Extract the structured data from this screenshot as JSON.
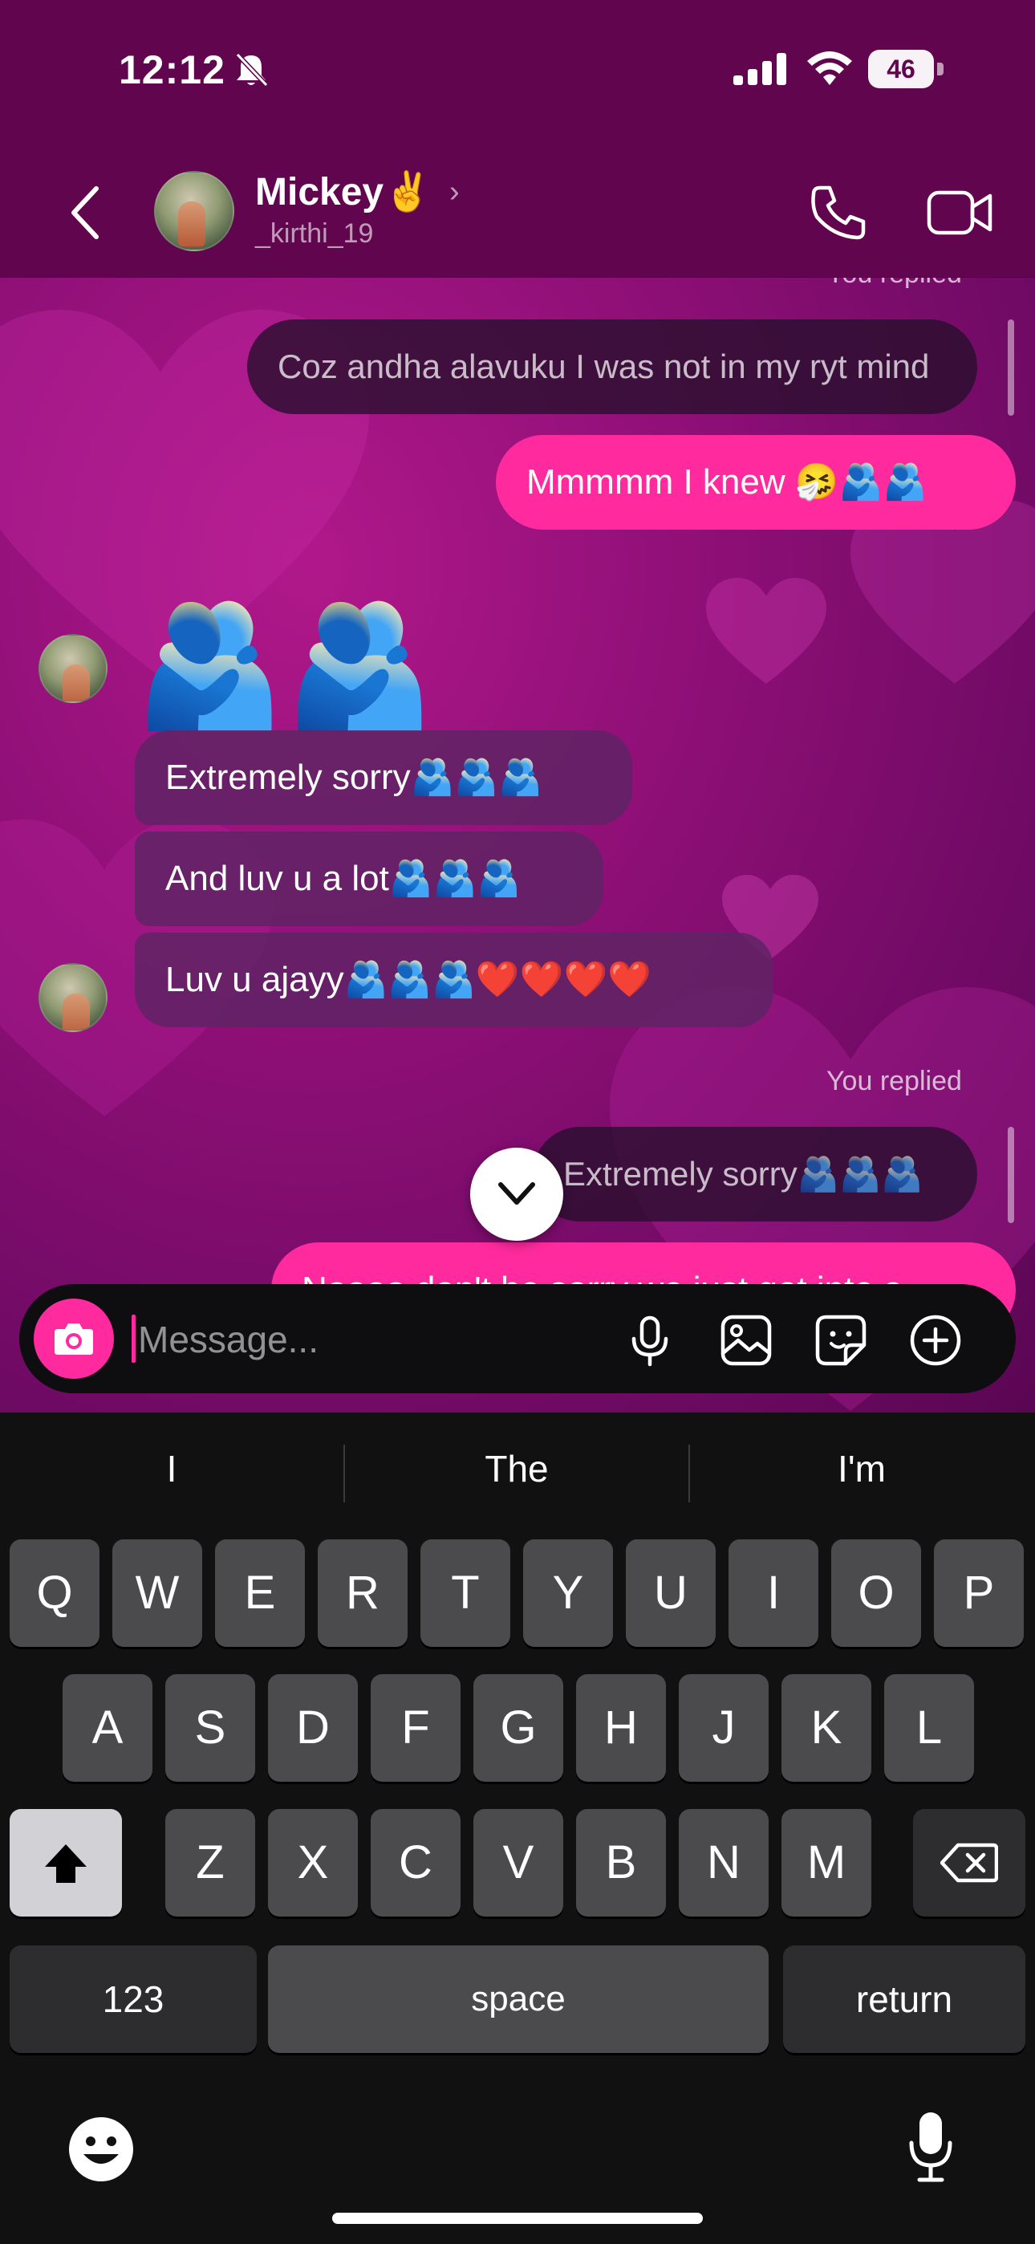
{
  "status_bar": {
    "time": "12:12",
    "battery": "46"
  },
  "header": {
    "contact_name": "Mickey✌️",
    "username": "_kirthi_19"
  },
  "messages": {
    "top_replied_label": "You replied",
    "reply_quote_1": "Coz andha alavuku I was not in my ryt mind",
    "sent_1": "Mmmmm I knew 🤧🫂🫂",
    "received_big_emoji": "🫂🫂",
    "received_1": "Extremely sorry🫂🫂🫂",
    "received_2": "And luv u a lot🫂🫂🫂",
    "received_3": "Luv u ajayy🫂🫂🫂❤️❤️❤️❤️",
    "replied_label": "You replied",
    "reply_quote_2": "Extremely sorry🫂🫂🫂",
    "sent_2_partial": "Naaaa don't be sorry we just got into a"
  },
  "composer": {
    "placeholder": "Message..."
  },
  "keyboard": {
    "suggestions": [
      "I",
      "The",
      "I'm"
    ],
    "row1": [
      "Q",
      "W",
      "E",
      "R",
      "T",
      "Y",
      "U",
      "I",
      "O",
      "P"
    ],
    "row2": [
      "A",
      "S",
      "D",
      "F",
      "G",
      "H",
      "J",
      "K",
      "L"
    ],
    "row3": [
      "Z",
      "X",
      "C",
      "V",
      "B",
      "N",
      "M"
    ],
    "numbers_label": "123",
    "space_label": "space",
    "return_label": "return"
  },
  "colors": {
    "accent": "#ff2a9e",
    "header_bg": "#62054f",
    "chat_bg": "#8d0f76"
  }
}
